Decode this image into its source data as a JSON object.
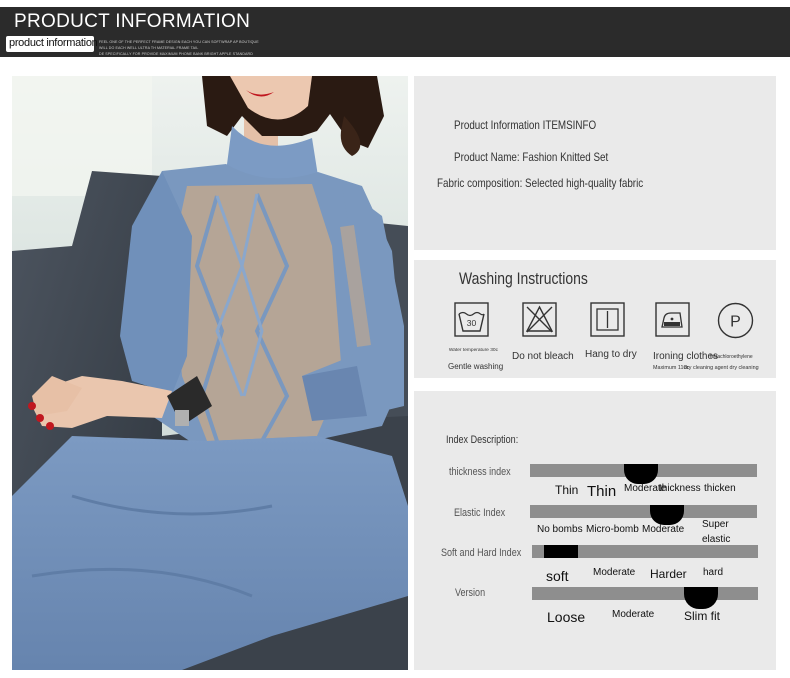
{
  "header": {
    "title": "PRODUCT INFORMATION",
    "subtitle": "product information",
    "fine_print": [
      "FEEL ONE OF THE PERFECT FRAME DESIGN EACH YOU CAN SOFTWRAP AP BOUTIQUE",
      "WILL DO EACH WELL ULTRA TH MATERIAL FRAME TAIL",
      "DE SPECIFICALLY FOR PROVIDE MAXIMUM PHONE BANK BRIGHT APPLE STANDARD"
    ]
  },
  "product_info": {
    "title": "Product Information ITEMSINFO",
    "name": "Product Name: Fashion Knitted Set",
    "fabric": "Fabric composition: Selected high-quality fabric"
  },
  "washing": {
    "title": "Washing Instructions",
    "icons": [
      {
        "icon": "wash-30-icon",
        "badge": "30",
        "caption_small": "Water temperature 30c",
        "caption": "Gentle washing"
      },
      {
        "icon": "no-bleach-icon",
        "caption": "Do not bleach"
      },
      {
        "icon": "hang-dry-icon",
        "caption": "Hang to dry"
      },
      {
        "icon": "iron-icon",
        "caption": "Ironing clothes",
        "caption_small": "Maximum 110c"
      },
      {
        "icon": "dry-clean-p-icon",
        "badge": "P",
        "caption_small": "Tetrachloroethylene",
        "caption_small_2": "dry cleaning agent dry cleaning"
      }
    ]
  },
  "index": {
    "title": "Index Description:",
    "rows": [
      {
        "label": "thickness index",
        "levels": [
          "Thin",
          "Thin",
          "Moderate",
          "thickness",
          "thicken"
        ],
        "selected": 2
      },
      {
        "label": "Elastic Index",
        "levels": [
          "No bombs",
          "Micro-bomb",
          "Moderate",
          "Super elastic"
        ],
        "selected": 2
      },
      {
        "label": "Soft and Hard Index",
        "levels": [
          "soft",
          "Moderate",
          "Harder",
          "hard"
        ],
        "selected": 0
      },
      {
        "label": "Version",
        "levels": [
          "Loose",
          "Moderate",
          "Slim fit"
        ],
        "selected": 2
      }
    ]
  },
  "colors": {
    "banner": "#2b2b2b",
    "panel": "#eaeaea",
    "bar": "#8e8e8e",
    "marker": "#000000",
    "sweater_blue": "#7a98bf",
    "sweater_tan": "#b5a596"
  }
}
